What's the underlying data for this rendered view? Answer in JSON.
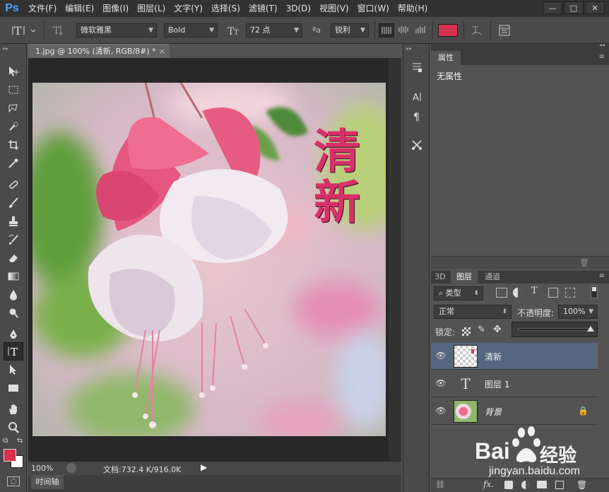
{
  "app": {
    "logo": "Ps"
  },
  "menu": [
    "文件(F)",
    "编辑(E)",
    "图像(I)",
    "图层(L)",
    "文字(Y)",
    "选择(S)",
    "滤镜(T)",
    "3D(D)",
    "视图(V)",
    "窗口(W)",
    "帮助(H)"
  ],
  "window_controls": {
    "minimize": "—",
    "restore": "□",
    "close": "✕"
  },
  "options": {
    "font_family": "微软雅黑",
    "font_style": "Bold",
    "font_size": "72 点",
    "aa_label": "ªa",
    "antialias": "锐利",
    "text_color": "#d8314f"
  },
  "document": {
    "tab_title": "1.jpg @ 100% (清新, RGB/8#) *",
    "close": "×",
    "overlay_text_line1": "清",
    "overlay_text_line2": "新",
    "overlay_color": "#d8316a"
  },
  "status": {
    "zoom": "100%",
    "doc_info": "文档:732.4 K/916.0K"
  },
  "timeline": {
    "tab": "时间轴"
  },
  "colors": {
    "foreground": "#d8314f",
    "background": "#ffffff"
  },
  "properties": {
    "tab": "属性",
    "empty_label": "无属性"
  },
  "layers": {
    "tabs": [
      "3D",
      "图层",
      "通道"
    ],
    "filter_kind": "类型",
    "blend_mode": "正常",
    "opacity_label": "不透明度:",
    "opacity_value": "100%",
    "lock_label": "锁定:",
    "items": [
      {
        "name": "清新",
        "type": "raster",
        "selected": true
      },
      {
        "name": "图层 1",
        "type": "text",
        "selected": false
      },
      {
        "name": "背景",
        "type": "image",
        "selected": false,
        "locked": true
      }
    ]
  },
  "watermark": {
    "brand": "Bai",
    "brand_cn": "经验",
    "url": "jingyan.baidu.com"
  }
}
